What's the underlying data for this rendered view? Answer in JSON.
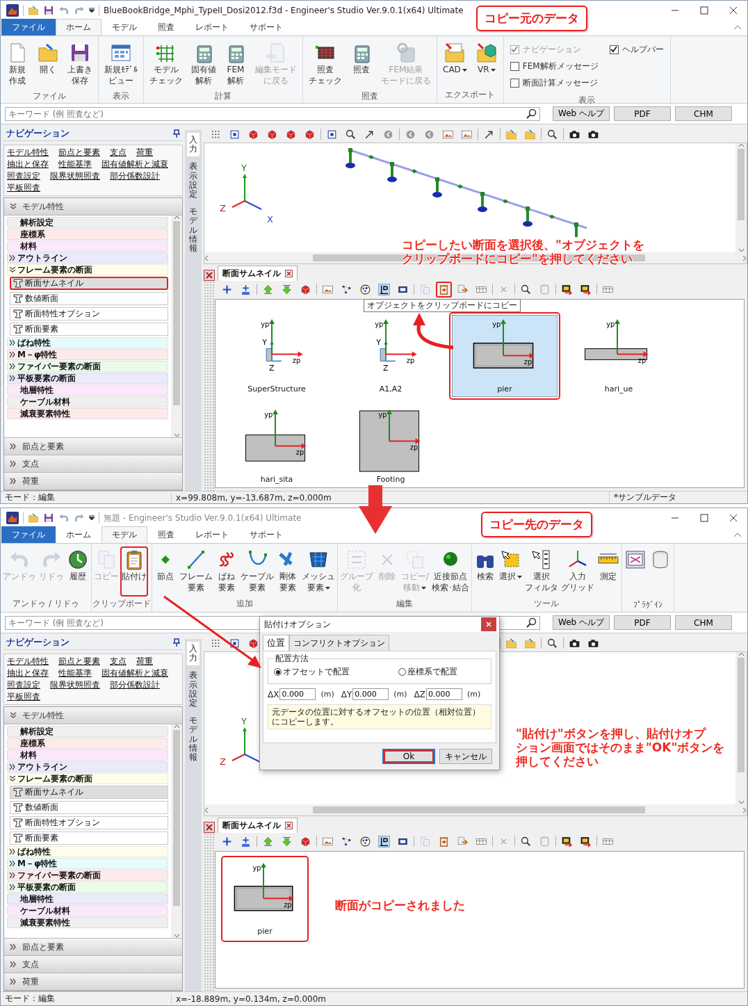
{
  "windows": [
    {
      "title": "BlueBookBridge_Mphi_TypeII_Dosi2012.f3d - Engineer's Studio Ver.9.0.1(x64) Ultimate",
      "active": true,
      "tabs": [
        {
          "label": "ファイル",
          "kind": "file",
          "selected": false
        },
        {
          "label": "ホーム",
          "kind": "tab",
          "selected": true
        },
        {
          "label": "モデル",
          "kind": "tab",
          "selected": false
        },
        {
          "label": "照査",
          "kind": "tab",
          "selected": false
        },
        {
          "label": "レポート",
          "kind": "tab",
          "selected": false
        },
        {
          "label": "サポート",
          "kind": "tab",
          "selected": false
        }
      ],
      "ribbon": [
        {
          "label": "ファイル",
          "items": [
            {
              "kind": "button",
              "lines": [
                "新規",
                "作成"
              ],
              "disabled": false
            },
            {
              "kind": "button",
              "lines": [
                "開く"
              ],
              "disabled": false
            },
            {
              "kind": "button",
              "lines": [
                "上書き",
                "保存"
              ],
              "disabled": false
            }
          ]
        },
        {
          "label": "表示",
          "items": [
            {
              "kind": "button",
              "lines": [
                "新規ﾓﾃﾞﾙ",
                "ビュー"
              ],
              "disabled": false
            }
          ]
        },
        {
          "label": "計算",
          "items": [
            {
              "kind": "button",
              "lines": [
                "モデル",
                "チェック"
              ],
              "disabled": false
            },
            {
              "kind": "button",
              "lines": [
                "固有値",
                "解析"
              ],
              "disabled": false
            },
            {
              "kind": "button",
              "lines": [
                "FEM",
                "解析"
              ],
              "disabled": false
            },
            {
              "kind": "button",
              "lines": [
                "編集モード",
                "に戻る"
              ],
              "disabled": true
            }
          ]
        },
        {
          "label": "照査",
          "items": [
            {
              "kind": "button",
              "lines": [
                "照査",
                "チェック"
              ],
              "disabled": false
            },
            {
              "kind": "button",
              "lines": [
                "照査"
              ],
              "disabled": false
            },
            {
              "kind": "button",
              "lines": [
                "FEM結果",
                "モードに戻る"
              ],
              "disabled": true
            }
          ]
        },
        {
          "label": "エクスポート",
          "items": [
            {
              "kind": "button",
              "lines": [
                "CAD"
              ],
              "dropdown": true,
              "disabled": false
            },
            {
              "kind": "button",
              "lines": [
                "VR"
              ],
              "dropdown": true,
              "disabled": false
            }
          ]
        },
        {
          "label": "表示",
          "items": [
            {
              "kind": "check",
              "label": "ナビゲーション",
              "checked": true,
              "disabled": true
            },
            {
              "kind": "check",
              "label": "FEM解析メッセージ",
              "checked": false,
              "disabled": false
            },
            {
              "kind": "check",
              "label": "断面計算メッセージ",
              "checked": false,
              "disabled": false
            },
            {
              "kind": "check",
              "label": "ヘルプバー",
              "checked": true,
              "disabled": false
            }
          ]
        }
      ],
      "search": {
        "placeholder": "キーワード (例 照査など)",
        "buttons": [
          "Web ヘルプ",
          "PDF",
          "CHM"
        ]
      },
      "nav": {
        "title": "ナビゲーション",
        "links": [
          [
            "モデル特性",
            "節点と要素",
            "支点",
            "荷重"
          ],
          [
            "抽出と保存",
            "性能基準",
            "固有値解析と減衰"
          ],
          [
            "照査設定",
            "限界状態照査",
            "部分係数設計"
          ],
          [
            "平板照査"
          ]
        ],
        "sections": [
          {
            "label": "モデル特性",
            "expanded": true,
            "items": [
              {
                "label": "解析設定",
                "kind": "leaf",
                "color": "#efefef"
              },
              {
                "label": "座標系",
                "kind": "leaf",
                "color": "#fdeaea"
              },
              {
                "label": "材料",
                "kind": "leaf",
                "color": "#fbe8fb"
              },
              {
                "label": "アウトライン",
                "kind": "folder",
                "expanded": false,
                "color": "#eaeafb"
              },
              {
                "label": "フレーム要素の断面",
                "kind": "folder",
                "expanded": true,
                "color": "#fdfdea",
                "children": [
                  {
                    "label": "断面サムネイル",
                    "selected": true,
                    "highlight": true
                  },
                  {
                    "label": "数値断面",
                    "selected": false,
                    "highlight": false
                  },
                  {
                    "label": "断面特性オプション",
                    "selected": false,
                    "highlight": false
                  },
                  {
                    "label": "断面要素",
                    "selected": false,
                    "highlight": false
                  }
                ]
              },
              {
                "label": "ばね特性",
                "kind": "folder",
                "expanded": false,
                "color": "#e8fbfb"
              },
              {
                "label": "M－φ特性",
                "kind": "folder",
                "expanded": false,
                "color": "#fdeaea"
              },
              {
                "label": "ファイバー要素の断面",
                "kind": "folder",
                "expanded": false,
                "color": "#eafbea"
              },
              {
                "label": "平板要素の断面",
                "kind": "folder",
                "expanded": false,
                "color": "#eaeafb"
              },
              {
                "label": "地層特性",
                "kind": "leaf",
                "color": "#fbe8fb"
              },
              {
                "label": "ケーブル材料",
                "kind": "leaf",
                "color": "#efefef"
              },
              {
                "label": "減衰要素特性",
                "kind": "leaf",
                "color": "#fdeaea"
              }
            ]
          },
          {
            "label": "節点と要素",
            "expanded": false
          },
          {
            "label": "支点",
            "expanded": false
          },
          {
            "label": "荷重",
            "expanded": false
          }
        ]
      },
      "side_tabs": [
        {
          "label": "入力",
          "selected": true
        },
        {
          "label": "表示設定",
          "selected": false
        },
        {
          "label": "モデル情報",
          "selected": false
        }
      ],
      "view": {
        "model_shown": true,
        "axes": [
          "Y",
          "Z",
          "X"
        ]
      },
      "panel": {
        "title": "断面サムネイル",
        "copy_tool_highlight": true,
        "tooltip": "オブジェクトをクリップボードにコピー",
        "thumbnails": [
          {
            "name": "SuperStructure",
            "kind": "tee",
            "axis_labels": [
              "yp",
              "zp"
            ],
            "local_axis_labels": [
              "Y",
              "Z"
            ],
            "selected": false,
            "highlight": false
          },
          {
            "name": "A1,A2",
            "kind": "tee",
            "axis_labels": [
              "yp",
              "zp"
            ],
            "local_axis_labels": [
              "Y",
              "Z"
            ],
            "selected": false,
            "highlight": false
          },
          {
            "name": "pier",
            "kind": "pier",
            "axis_labels": [
              "yp",
              "zp"
            ],
            "selected": true,
            "highlight": true
          },
          {
            "name": "hari_ue",
            "kind": "slab",
            "axis_labels": [
              "yp",
              "zp"
            ],
            "selected": false,
            "highlight": false
          },
          {
            "name": "hari_sita",
            "kind": "rect",
            "axis_labels": [
              "yp",
              "zp"
            ],
            "selected": false,
            "highlight": false
          },
          {
            "name": "Footing",
            "kind": "square",
            "axis_labels": [
              "yp",
              "zp"
            ],
            "selected": false,
            "highlight": false
          }
        ]
      },
      "status": [
        "モード：編集",
        "x=99.808m, y=-13.687m, z=0.000m",
        "*サンプルデータ"
      ]
    },
    {
      "title": "無題 - Engineer's Studio Ver.9.0.1(x64) Ultimate",
      "active": false,
      "tabs": [
        {
          "label": "ファイル",
          "kind": "file",
          "selected": false
        },
        {
          "label": "ホーム",
          "kind": "tab",
          "selected": false
        },
        {
          "label": "モデル",
          "kind": "tab",
          "selected": true
        },
        {
          "label": "照査",
          "kind": "tab",
          "selected": false
        },
        {
          "label": "レポート",
          "kind": "tab",
          "selected": false
        },
        {
          "label": "サポート",
          "kind": "tab",
          "selected": false
        }
      ],
      "ribbon": [
        {
          "label": "アンドゥ / リドゥ",
          "items": [
            {
              "kind": "button",
              "lines": [
                "アンドゥ"
              ],
              "disabled": true
            },
            {
              "kind": "button",
              "lines": [
                "リドゥ"
              ],
              "disabled": true
            },
            {
              "kind": "button",
              "lines": [
                "履歴"
              ],
              "disabled": false
            }
          ]
        },
        {
          "label": "クリップボード",
          "items": [
            {
              "kind": "button",
              "lines": [
                "コピー"
              ],
              "disabled": true
            },
            {
              "kind": "button",
              "lines": [
                "貼付け"
              ],
              "disabled": false,
              "highlight": true
            }
          ]
        },
        {
          "label": "追加",
          "items": [
            {
              "kind": "button",
              "lines": [
                "節点"
              ],
              "disabled": false
            },
            {
              "kind": "button",
              "lines": [
                "フレーム",
                "要素"
              ],
              "disabled": false
            },
            {
              "kind": "button",
              "lines": [
                "ばね",
                "要素"
              ],
              "disabled": false
            },
            {
              "kind": "button",
              "lines": [
                "ケーブル",
                "要素"
              ],
              "disabled": false
            },
            {
              "kind": "button",
              "lines": [
                "剛体",
                "要素"
              ],
              "disabled": false
            },
            {
              "kind": "button",
              "lines": [
                "メッシュ",
                "要素"
              ],
              "dropdown": true,
              "disabled": false
            }
          ]
        },
        {
          "label": "編集",
          "items": [
            {
              "kind": "button",
              "lines": [
                "グループ",
                "化"
              ],
              "disabled": true
            },
            {
              "kind": "button",
              "lines": [
                "削除"
              ],
              "disabled": true
            },
            {
              "kind": "button",
              "lines": [
                "コピー/",
                "移動"
              ],
              "dropdown": true,
              "disabled": true
            },
            {
              "kind": "button",
              "lines": [
                "近接節点",
                "検索･結合"
              ],
              "disabled": false
            }
          ]
        },
        {
          "label": "ツール",
          "items": [
            {
              "kind": "button",
              "lines": [
                "検索"
              ],
              "disabled": false
            },
            {
              "kind": "button",
              "lines": [
                "選択"
              ],
              "dropdown": true,
              "disabled": false
            },
            {
              "kind": "button",
              "lines": [
                "選択",
                "フィルタ"
              ],
              "disabled": false
            },
            {
              "kind": "button",
              "lines": [
                "入力",
                "グリッド"
              ],
              "disabled": false
            },
            {
              "kind": "button",
              "lines": [
                "測定"
              ],
              "disabled": false
            }
          ]
        },
        {
          "label": "ﾌﾟﾗｸﾞｲﾝ",
          "items": [
            {
              "kind": "tool"
            },
            {
              "kind": "tool"
            }
          ]
        }
      ],
      "search": {
        "placeholder": "キーワード (例 照査など)",
        "buttons": [
          "Web ヘルプ",
          "PDF",
          "CHM"
        ]
      },
      "nav": {
        "title": "ナビゲーション",
        "links": [
          [
            "モデル特性",
            "節点と要素",
            "支点",
            "荷重"
          ],
          [
            "抽出と保存",
            "性能基準",
            "固有値解析と減衰"
          ],
          [
            "照査設定",
            "限界状態照査",
            "部分係数設計"
          ],
          [
            "平板照査"
          ]
        ],
        "sections": [
          {
            "label": "モデル特性",
            "expanded": true,
            "items": [
              {
                "label": "解析設定",
                "kind": "leaf",
                "color": "#efefef"
              },
              {
                "label": "座標系",
                "kind": "leaf",
                "color": "#fdeaea"
              },
              {
                "label": "材料",
                "kind": "leaf",
                "color": "#fbe8fb"
              },
              {
                "label": "アウトライン",
                "kind": "folder",
                "expanded": false,
                "color": "#eaeafb"
              },
              {
                "label": "フレーム要素の断面",
                "kind": "folder",
                "expanded": true,
                "color": "#fdfdea",
                "children": [
                  {
                    "label": "断面サムネイル",
                    "selected": true,
                    "highlight": false
                  },
                  {
                    "label": "数値断面",
                    "selected": false,
                    "highlight": false
                  },
                  {
                    "label": "断面特性オプション",
                    "selected": false,
                    "highlight": false
                  },
                  {
                    "label": "断面要素",
                    "selected": false,
                    "highlight": false
                  }
                ]
              },
              {
                "label": "ばね特性",
                "kind": "folder",
                "expanded": false,
                "color": "#fdfdea"
              },
              {
                "label": "M－φ特性",
                "kind": "folder",
                "expanded": false,
                "color": "#e8fbfb"
              },
              {
                "label": "ファイバー要素の断面",
                "kind": "folder",
                "expanded": false,
                "color": "#fdeaea"
              },
              {
                "label": "平板要素の断面",
                "kind": "folder",
                "expanded": false,
                "color": "#eafbea"
              },
              {
                "label": "地層特性",
                "kind": "leaf",
                "color": "#eaeafb"
              },
              {
                "label": "ケーブル材料",
                "kind": "leaf",
                "color": "#fbe8fb"
              },
              {
                "label": "減衰要素特性",
                "kind": "leaf",
                "color": "#efefef"
              }
            ]
          },
          {
            "label": "節点と要素",
            "expanded": false
          },
          {
            "label": "支点",
            "expanded": false
          },
          {
            "label": "荷重",
            "expanded": false
          }
        ]
      },
      "side_tabs": [
        {
          "label": "入力",
          "selected": true
        },
        {
          "label": "表示設定",
          "selected": false
        },
        {
          "label": "モデル情報",
          "selected": false
        }
      ],
      "view": {
        "model_shown": false,
        "axes": [
          "Y",
          "Z"
        ]
      },
      "panel": {
        "title": "断面サムネイル",
        "copy_tool_highlight": false,
        "thumbnails": [
          {
            "name": "pier",
            "kind": "pier",
            "axis_labels": [
              "yp",
              "zp"
            ],
            "selected": false,
            "highlight": true
          }
        ]
      },
      "dialog": {
        "title": "貼付けオプション",
        "tabs": [
          {
            "label": "位置",
            "selected": true
          },
          {
            "label": "コンフリクトオプション",
            "selected": false
          }
        ],
        "group": "配置方法",
        "radios": [
          {
            "label": "オフセットで配置",
            "selected": true
          },
          {
            "label": "座標系で配置",
            "selected": false
          }
        ],
        "fields": [
          {
            "label": "ΔX",
            "value": "0.000",
            "unit": "(m)"
          },
          {
            "label": "ΔY",
            "value": "0.000",
            "unit": "(m)"
          },
          {
            "label": "ΔZ",
            "value": "0.000",
            "unit": "(m)"
          }
        ],
        "info": "元データの位置に対するオフセットの位置（相対位置）にコピーします。",
        "buttons": [
          {
            "label": "Ok",
            "default": true,
            "highlight": true
          },
          {
            "label": "キャンセル",
            "default": false,
            "highlight": false
          }
        ]
      },
      "status": [
        "モード：編集",
        "x=-18.889m, y=0.134m, z=0.000m"
      ]
    }
  ],
  "annotations": [
    {
      "kind": "callout",
      "text": "コピー元のデータ"
    },
    {
      "kind": "note",
      "lines": [
        "コピーしたい断面を選択後、\"オブジェクトを",
        "クリップボードにコピー\"を押してください"
      ]
    },
    {
      "kind": "callout",
      "text": "コピー先のデータ"
    },
    {
      "kind": "note",
      "lines": [
        "\"貼付け\"ボタンを押し、貼付けオプ",
        "ション画面ではそのまま\"OK\"ボタンを",
        "押してください"
      ]
    },
    {
      "kind": "note",
      "lines": [
        "断面がコピーされました"
      ]
    }
  ]
}
